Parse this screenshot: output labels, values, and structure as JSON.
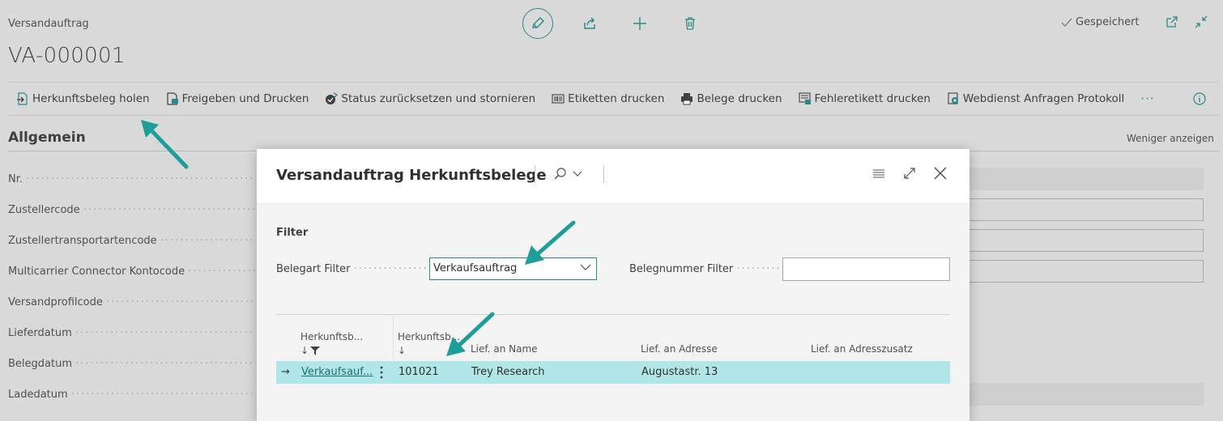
{
  "page": {
    "doc_type": "Versandauftrag",
    "doc_no": "VA-000001",
    "saved_label": "Gespeichert",
    "actions": [
      {
        "label": "Herkunftsbeleg holen",
        "icon": "get-document-icon"
      },
      {
        "label": "Freigeben und Drucken",
        "icon": "release-print-icon"
      },
      {
        "label": "Status zurücksetzen und stornieren",
        "icon": "reset-status-icon"
      },
      {
        "label": "Etiketten drucken",
        "icon": "barcode-icon"
      },
      {
        "label": "Belege drucken",
        "icon": "printer-icon"
      },
      {
        "label": "Fehleretikett drucken",
        "icon": "error-label-icon"
      },
      {
        "label": "Webdienst Anfragen Protokoll",
        "icon": "webservice-log-icon"
      }
    ],
    "more_label": "···"
  },
  "section": {
    "title": "Allgemein",
    "toggle_label": "Weniger anzeigen",
    "fields": [
      {
        "label": "Nr."
      },
      {
        "label": "Zustellercode"
      },
      {
        "label": "Zustellertransportartencode"
      },
      {
        "label": "Multicarrier Connector Kontocode"
      },
      {
        "label": "Versandprofilcode"
      },
      {
        "label": "Lieferdatum"
      },
      {
        "label": "Belegdatum"
      },
      {
        "label": "Ladedatum"
      }
    ]
  },
  "modal": {
    "title": "Versandauftrag Herkunftsbelege",
    "filter_title": "Filter",
    "belegart_label": "Belegart Filter",
    "belegart_value": "Verkaufsauftrag",
    "belegnummer_label": "Belegnummer Filter",
    "belegnummer_value": "",
    "columns": [
      {
        "label": "Herkunftsb...",
        "sort": "↓"
      },
      {
        "label": "Herkunftsb...",
        "sort": "↓"
      },
      {
        "label": "Lief. an Name"
      },
      {
        "label": "Lief. an Adresse"
      },
      {
        "label": "Lief. an Adresszusatz"
      }
    ],
    "rows": [
      {
        "arrow": "→",
        "type": "Verkaufsauf...",
        "no": "101021",
        "name": "Trey Research",
        "address": "Augustastr. 13",
        "address2": ""
      }
    ]
  },
  "colors": {
    "accent": "#2a8a87",
    "arrow": "#1e9e98",
    "row_highlight": "#b1e6e8",
    "background_dim": "#d9d9d9"
  }
}
